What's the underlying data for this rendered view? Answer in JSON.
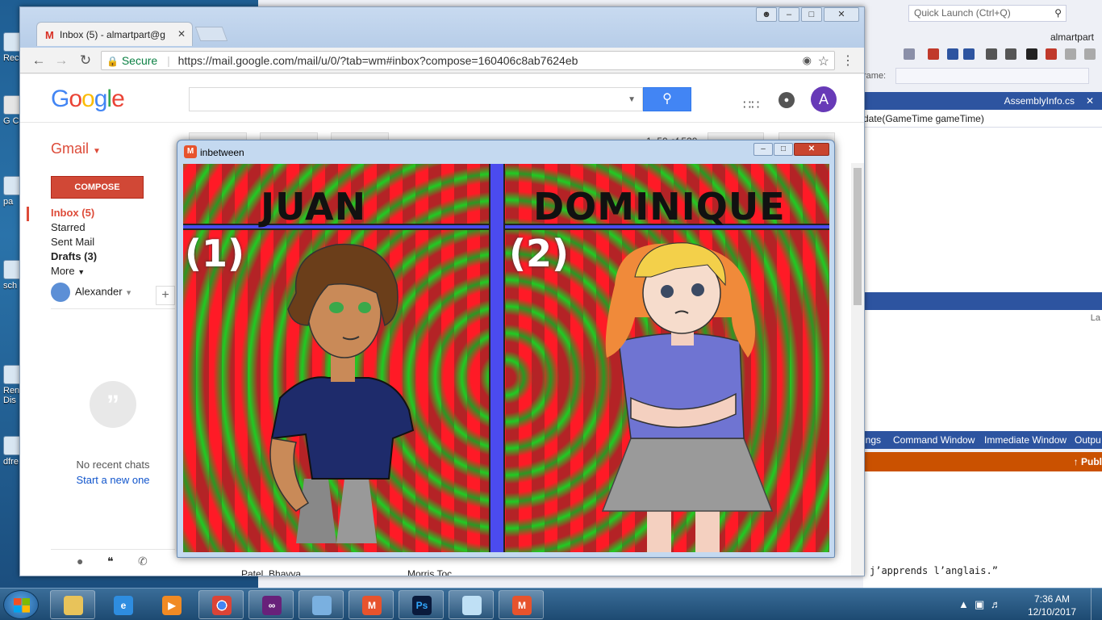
{
  "desktop": {
    "icons": [
      {
        "label": "Rec",
        "icon": "recycle-bin-icon"
      },
      {
        "label": "G C",
        "icon": "chrome-shortcut-icon"
      },
      {
        "label": "pa",
        "icon": "file-icon"
      },
      {
        "label": "sch h",
        "icon": "file-icon"
      },
      {
        "label": "Ren Dis",
        "icon": "remote-desktop-icon"
      },
      {
        "label": "dfre",
        "icon": "file-icon"
      }
    ]
  },
  "visual_studio": {
    "quick_launch_placeholder": "Quick Launch (Ctrl+Q)",
    "user": "almartpart",
    "frame_label": "rame:",
    "doc_tab": "AssemblyInfo.cs",
    "signature": "date(GameTime gameTime)",
    "panel_label": "La",
    "tool_tabs": [
      "ings",
      "Command Window",
      "Immediate Window",
      "Outpu"
    ],
    "publish_label": "Publ",
    "output_text": "j’apprends l’anglais.”"
  },
  "chrome": {
    "tab_title": "Inbox (5) - almartpart@g",
    "secure_label": "Secure",
    "url": "https://mail.google.com/mail/u/0/?tab=wm#inbox?compose=160406c8ab7624eb"
  },
  "gmail": {
    "logo": "Google",
    "brand": "Gmail",
    "compose_label": "COMPOSE",
    "nav": [
      {
        "label": "Inbox (5)",
        "state": "active"
      },
      {
        "label": "Starred",
        "state": "normal"
      },
      {
        "label": "Sent Mail",
        "state": "normal"
      },
      {
        "label": "Drafts (3)",
        "state": "bold"
      },
      {
        "label": "More",
        "state": "normal"
      }
    ],
    "user_name": "Alexander",
    "avatar_letter": "A",
    "no_chats": "No recent chats",
    "start_chat": "Start a new one",
    "count": "1–50 of 520",
    "row_sender": "Patel, Bhavya",
    "row_other": "Morris Toc"
  },
  "game_window": {
    "title": "inbetween",
    "player1_name": "JUAN",
    "player1_num": "(1)",
    "player2_name": "DOMINIQUE",
    "player2_num": "(2)",
    "colors": {
      "divider": "#4b4bee",
      "red": "#ff2433",
      "green": "#2bd62f"
    }
  },
  "taskbar": {
    "apps": [
      {
        "name": "explorer",
        "icon": "folder-icon"
      },
      {
        "name": "internet-explorer",
        "icon": "ie-icon"
      },
      {
        "name": "media-player",
        "icon": "media-player-icon"
      },
      {
        "name": "chrome",
        "icon": "chrome-icon"
      },
      {
        "name": "visual-studio",
        "icon": "visual-studio-icon"
      },
      {
        "name": "paint",
        "icon": "paint-icon"
      },
      {
        "name": "monogame-1",
        "icon": "monogame-icon"
      },
      {
        "name": "photoshop",
        "icon": "photoshop-icon",
        "label": "Ps"
      },
      {
        "name": "notepad",
        "icon": "notepad-icon"
      },
      {
        "name": "monogame-2",
        "icon": "monogame-icon"
      }
    ],
    "time": "7:36 AM",
    "date": "12/10/2017"
  }
}
